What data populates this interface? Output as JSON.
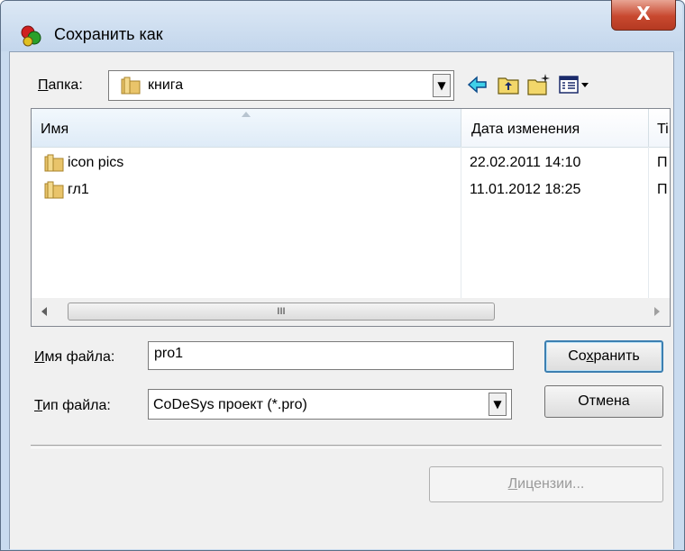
{
  "window": {
    "title": "Сохранить как",
    "close_label": "X"
  },
  "location": {
    "label_prefix": "П",
    "label_rest": "апка:",
    "folder": "книга"
  },
  "list": {
    "columns": [
      "Имя",
      "Дата изменения",
      "Ti"
    ],
    "rows": [
      {
        "name": "icon pics",
        "date": "22.02.2011 14:10",
        "type": "П"
      },
      {
        "name": "гл1",
        "date": "11.01.2012 18:25",
        "type": "П"
      }
    ],
    "scroll_thumb_grip": "III"
  },
  "filename": {
    "label_prefix": "И",
    "label_rest": "мя файла:",
    "value": "pro1"
  },
  "filetype": {
    "label_prefix": "Т",
    "label_rest": "ип файла:",
    "value": "CoDeSys проект (*.pro)"
  },
  "buttons": {
    "save_pre": "Со",
    "save_u": "х",
    "save_post": "ранить",
    "cancel": "Отмена",
    "license_u": "Л",
    "license_post": "ицензии..."
  },
  "icons": {
    "folder": "folder-icon",
    "back": "back-arrow-icon",
    "up": "up-folder-icon",
    "new_folder": "new-folder-icon",
    "view": "view-menu-icon"
  },
  "colors": {
    "titlebar": "#c9dbef",
    "close": "#c8482f",
    "default_button_border": "#3c7fb1"
  }
}
